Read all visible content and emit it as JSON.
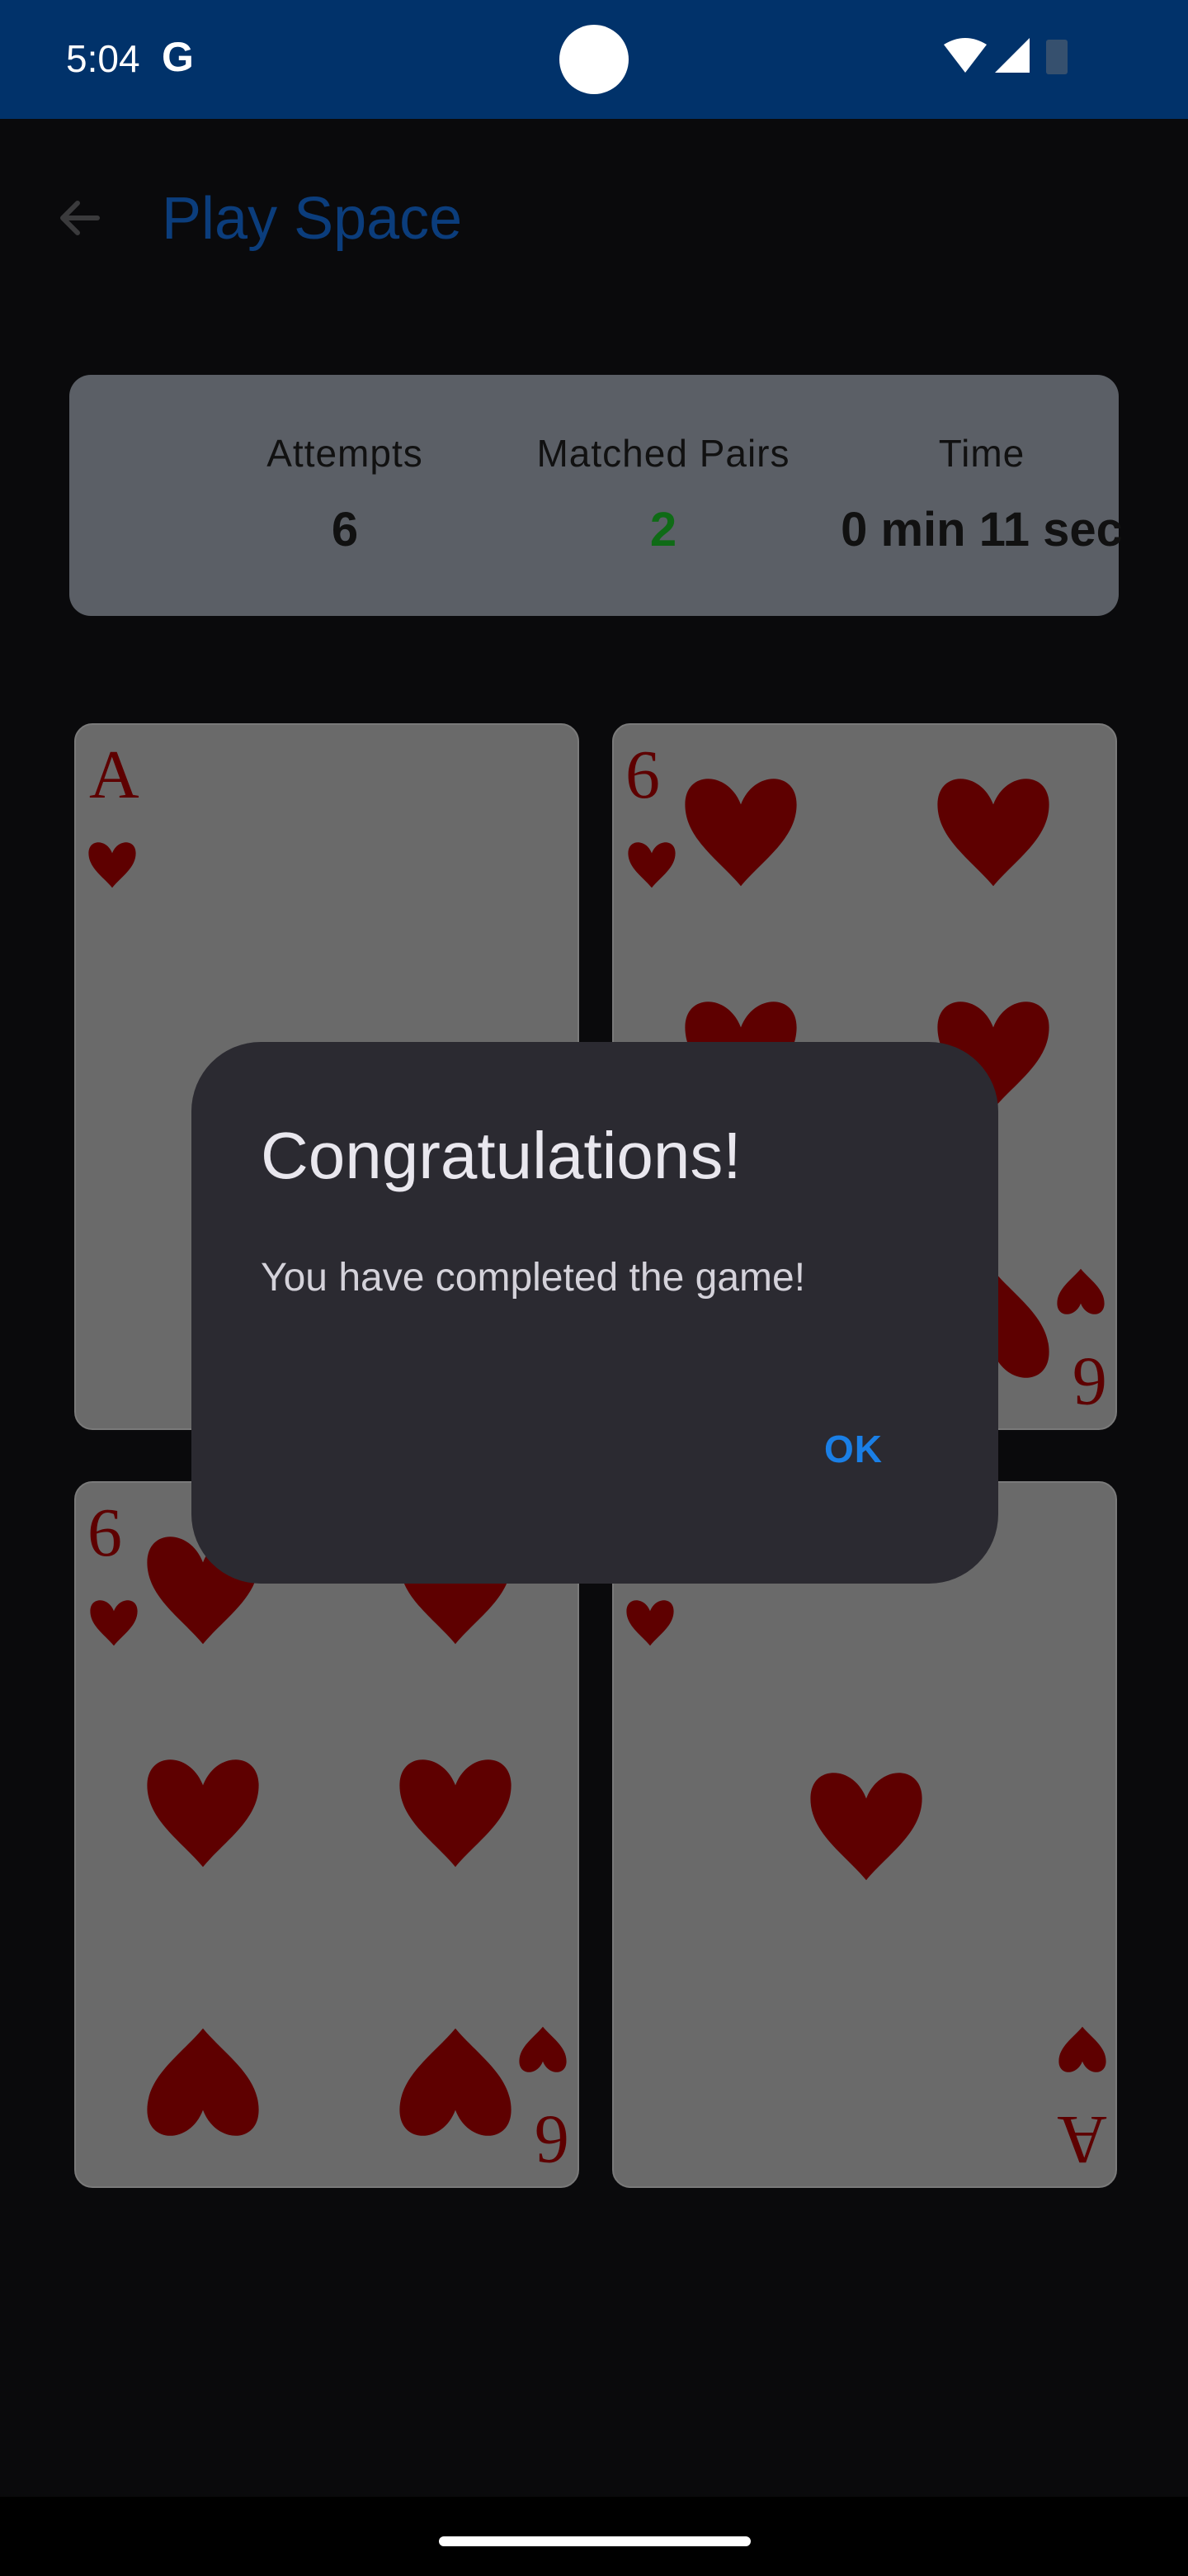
{
  "status_bar": {
    "time": "5:04",
    "g_label": "G"
  },
  "app_bar": {
    "title": "Play Space"
  },
  "stats": {
    "attempts_label": "Attempts",
    "attempts_value": "6",
    "pairs_label": "Matched Pairs",
    "pairs_value": "2",
    "time_label": "Time",
    "time_value": "0 min 11 sec"
  },
  "cards": [
    {
      "rank": "A",
      "suit": "hearts"
    },
    {
      "rank": "6",
      "suit": "hearts"
    },
    {
      "rank": "6",
      "suit": "hearts"
    },
    {
      "rank": "A",
      "suit": "hearts"
    }
  ],
  "dialog": {
    "title": "Congratulations!",
    "message": "You have completed the game!",
    "ok_label": "OK"
  },
  "colors": {
    "status_bar": "#01326a",
    "card_red": "#5e0000",
    "accent": "#1a7fe6",
    "pairs_green": "#0f6b16"
  },
  "icons": [
    "wifi-icon",
    "signal-icon",
    "battery-icon",
    "back-arrow-icon"
  ]
}
